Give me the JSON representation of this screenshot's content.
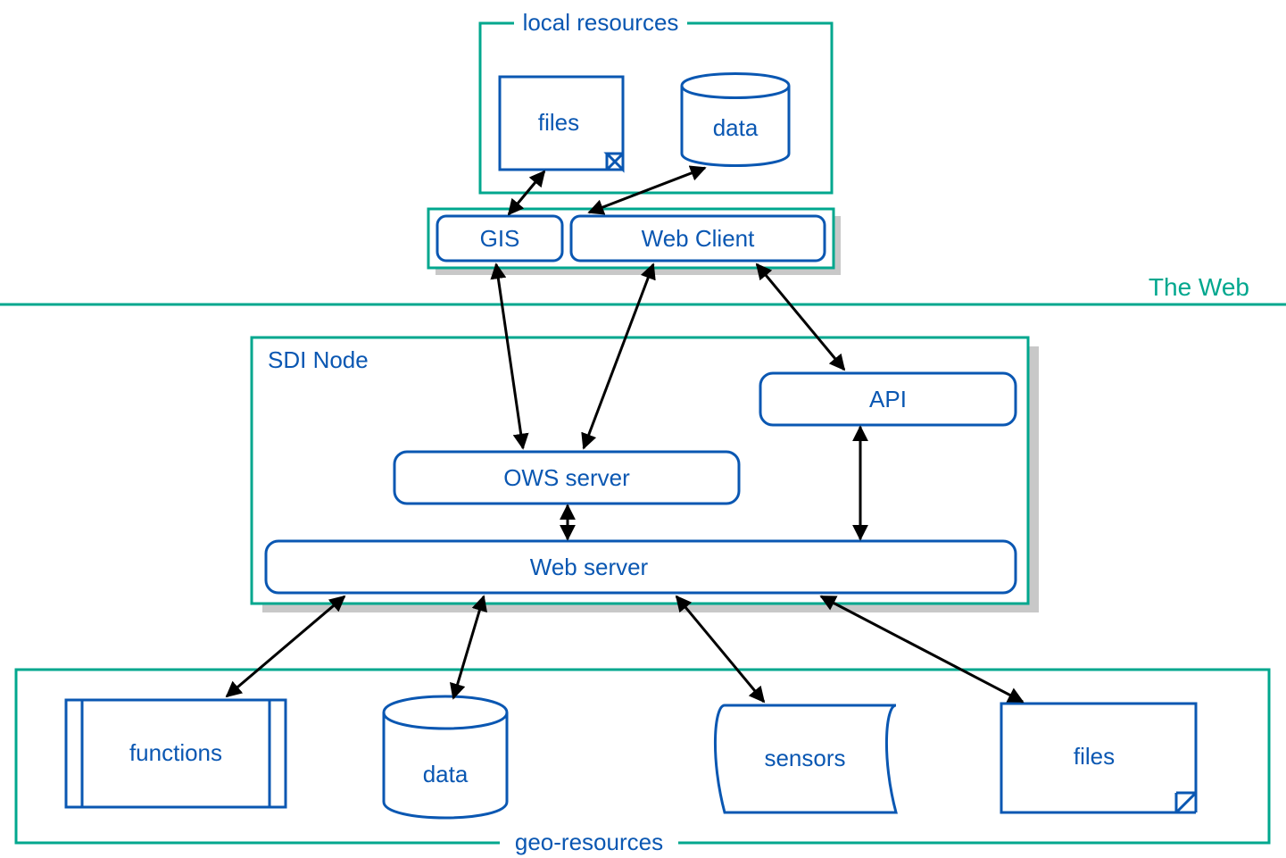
{
  "colors": {
    "teal": "#00A78E",
    "blue": "#0A57B2",
    "shadow": "#C8C8C8",
    "arrow": "#000000"
  },
  "groups": {
    "local_resources": {
      "label": "local resources"
    },
    "sdi_node": {
      "label": "SDI Node"
    },
    "geo_resources": {
      "label": "geo-resources"
    },
    "the_web": {
      "label": "The Web"
    }
  },
  "nodes": {
    "files_top": {
      "label": "files"
    },
    "data_top": {
      "label": "data"
    },
    "gis": {
      "label": "GIS"
    },
    "web_client": {
      "label": "Web Client"
    },
    "api": {
      "label": "API"
    },
    "ows_server": {
      "label": "OWS server"
    },
    "web_server": {
      "label": "Web server"
    },
    "functions": {
      "label": "functions"
    },
    "data_bot": {
      "label": "data"
    },
    "sensors": {
      "label": "sensors"
    },
    "files_bot": {
      "label": "files"
    }
  }
}
